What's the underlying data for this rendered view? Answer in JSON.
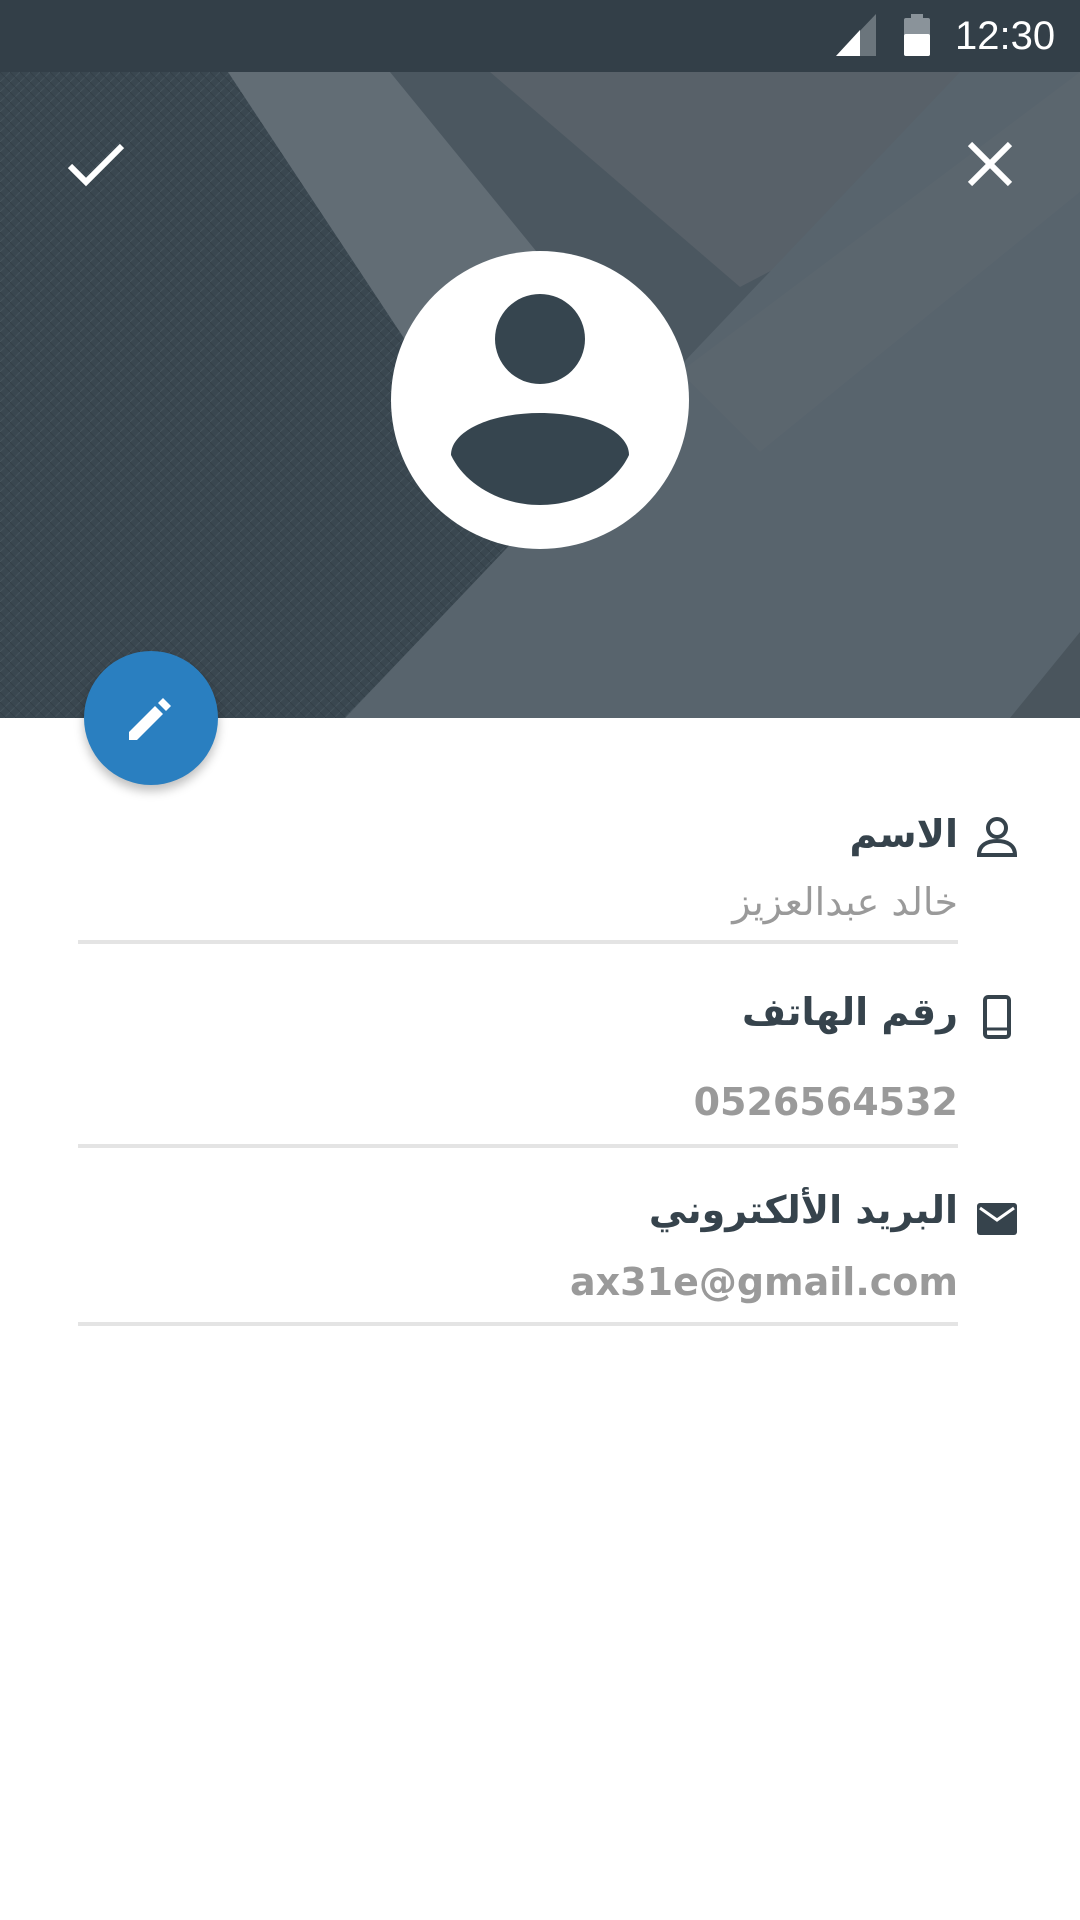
{
  "status_bar": {
    "time": "12:30",
    "signal_icon": "signal-icon",
    "battery_icon": "battery-icon"
  },
  "header": {
    "confirm_icon": "check-icon",
    "close_icon": "close-icon",
    "avatar_icon": "person-avatar-icon"
  },
  "fab": {
    "icon": "pencil-icon",
    "color": "#2a7fc0"
  },
  "form": {
    "name": {
      "label": "الاسم",
      "value": "خالد عبدالعزيز",
      "icon": "person-icon"
    },
    "phone": {
      "label": "رقم الهاتف",
      "value": "0526564532",
      "icon": "phone-icon"
    },
    "email": {
      "label": "البريد الألكتروني",
      "value": "ax31e@gmail.com",
      "icon": "mail-icon"
    }
  },
  "colors": {
    "status_bar": "#333f48",
    "header_dark": "#3a4750",
    "header_light": "#58646d",
    "label_text": "#36434c",
    "value_text": "#9a9a9a"
  }
}
